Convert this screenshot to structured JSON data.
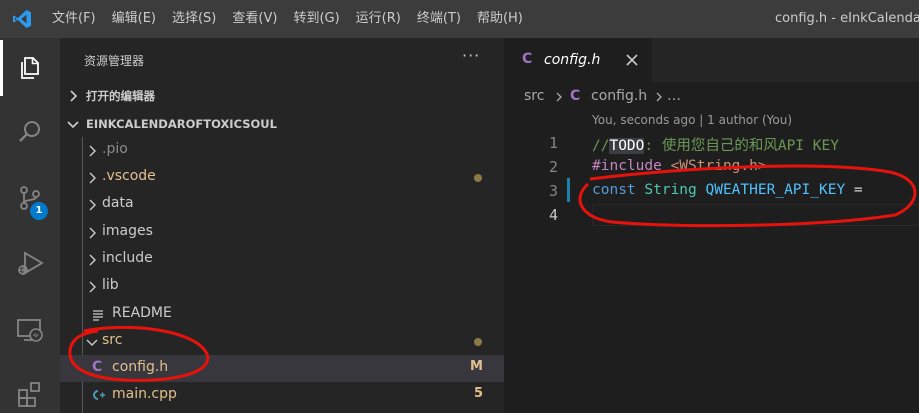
{
  "menu": [
    "文件(F)",
    "编辑(E)",
    "选择(S)",
    "查看(V)",
    "转到(G)",
    "运行(R)",
    "终端(T)",
    "帮助(H)"
  ],
  "window_title": "config.h - eInkCalenda",
  "activity": {
    "scm_badge": "1"
  },
  "sidebar": {
    "title": "资源管理器",
    "more": "···",
    "open_editors": "打开的编辑器",
    "project": "EINKCALENDAROFTOXICSOUL",
    "items": [
      {
        "label": ".pio"
      },
      {
        "label": ".vscode"
      },
      {
        "label": "data"
      },
      {
        "label": "images"
      },
      {
        "label": "include"
      },
      {
        "label": "lib"
      },
      {
        "label": "README"
      },
      {
        "label": "src"
      },
      {
        "label": "config.h",
        "status": "M"
      },
      {
        "label": "main.cpp",
        "status": "5"
      }
    ]
  },
  "editor": {
    "tab_label": "config.h",
    "tab_icon": "C",
    "breadcrumb_folder": "src",
    "breadcrumb_file": "config.h",
    "breadcrumb_more": "…",
    "codelens": "You, seconds ago | 1 author (You)",
    "line_numbers": [
      "1",
      "2",
      "3",
      "4"
    ],
    "line1": {
      "slashes": "//",
      "todo": "TODO",
      "rest": ": 使用您自己的和风API KEY"
    },
    "line2": {
      "directive": "#include",
      "header": " <WString.h>"
    },
    "line3": {
      "kw": "const",
      "type": " String",
      "var": " QWEATHER_API_KEY",
      "rest": " ="
    }
  },
  "colors": {
    "accent": "#007acc",
    "annotation": "#e8120c"
  }
}
